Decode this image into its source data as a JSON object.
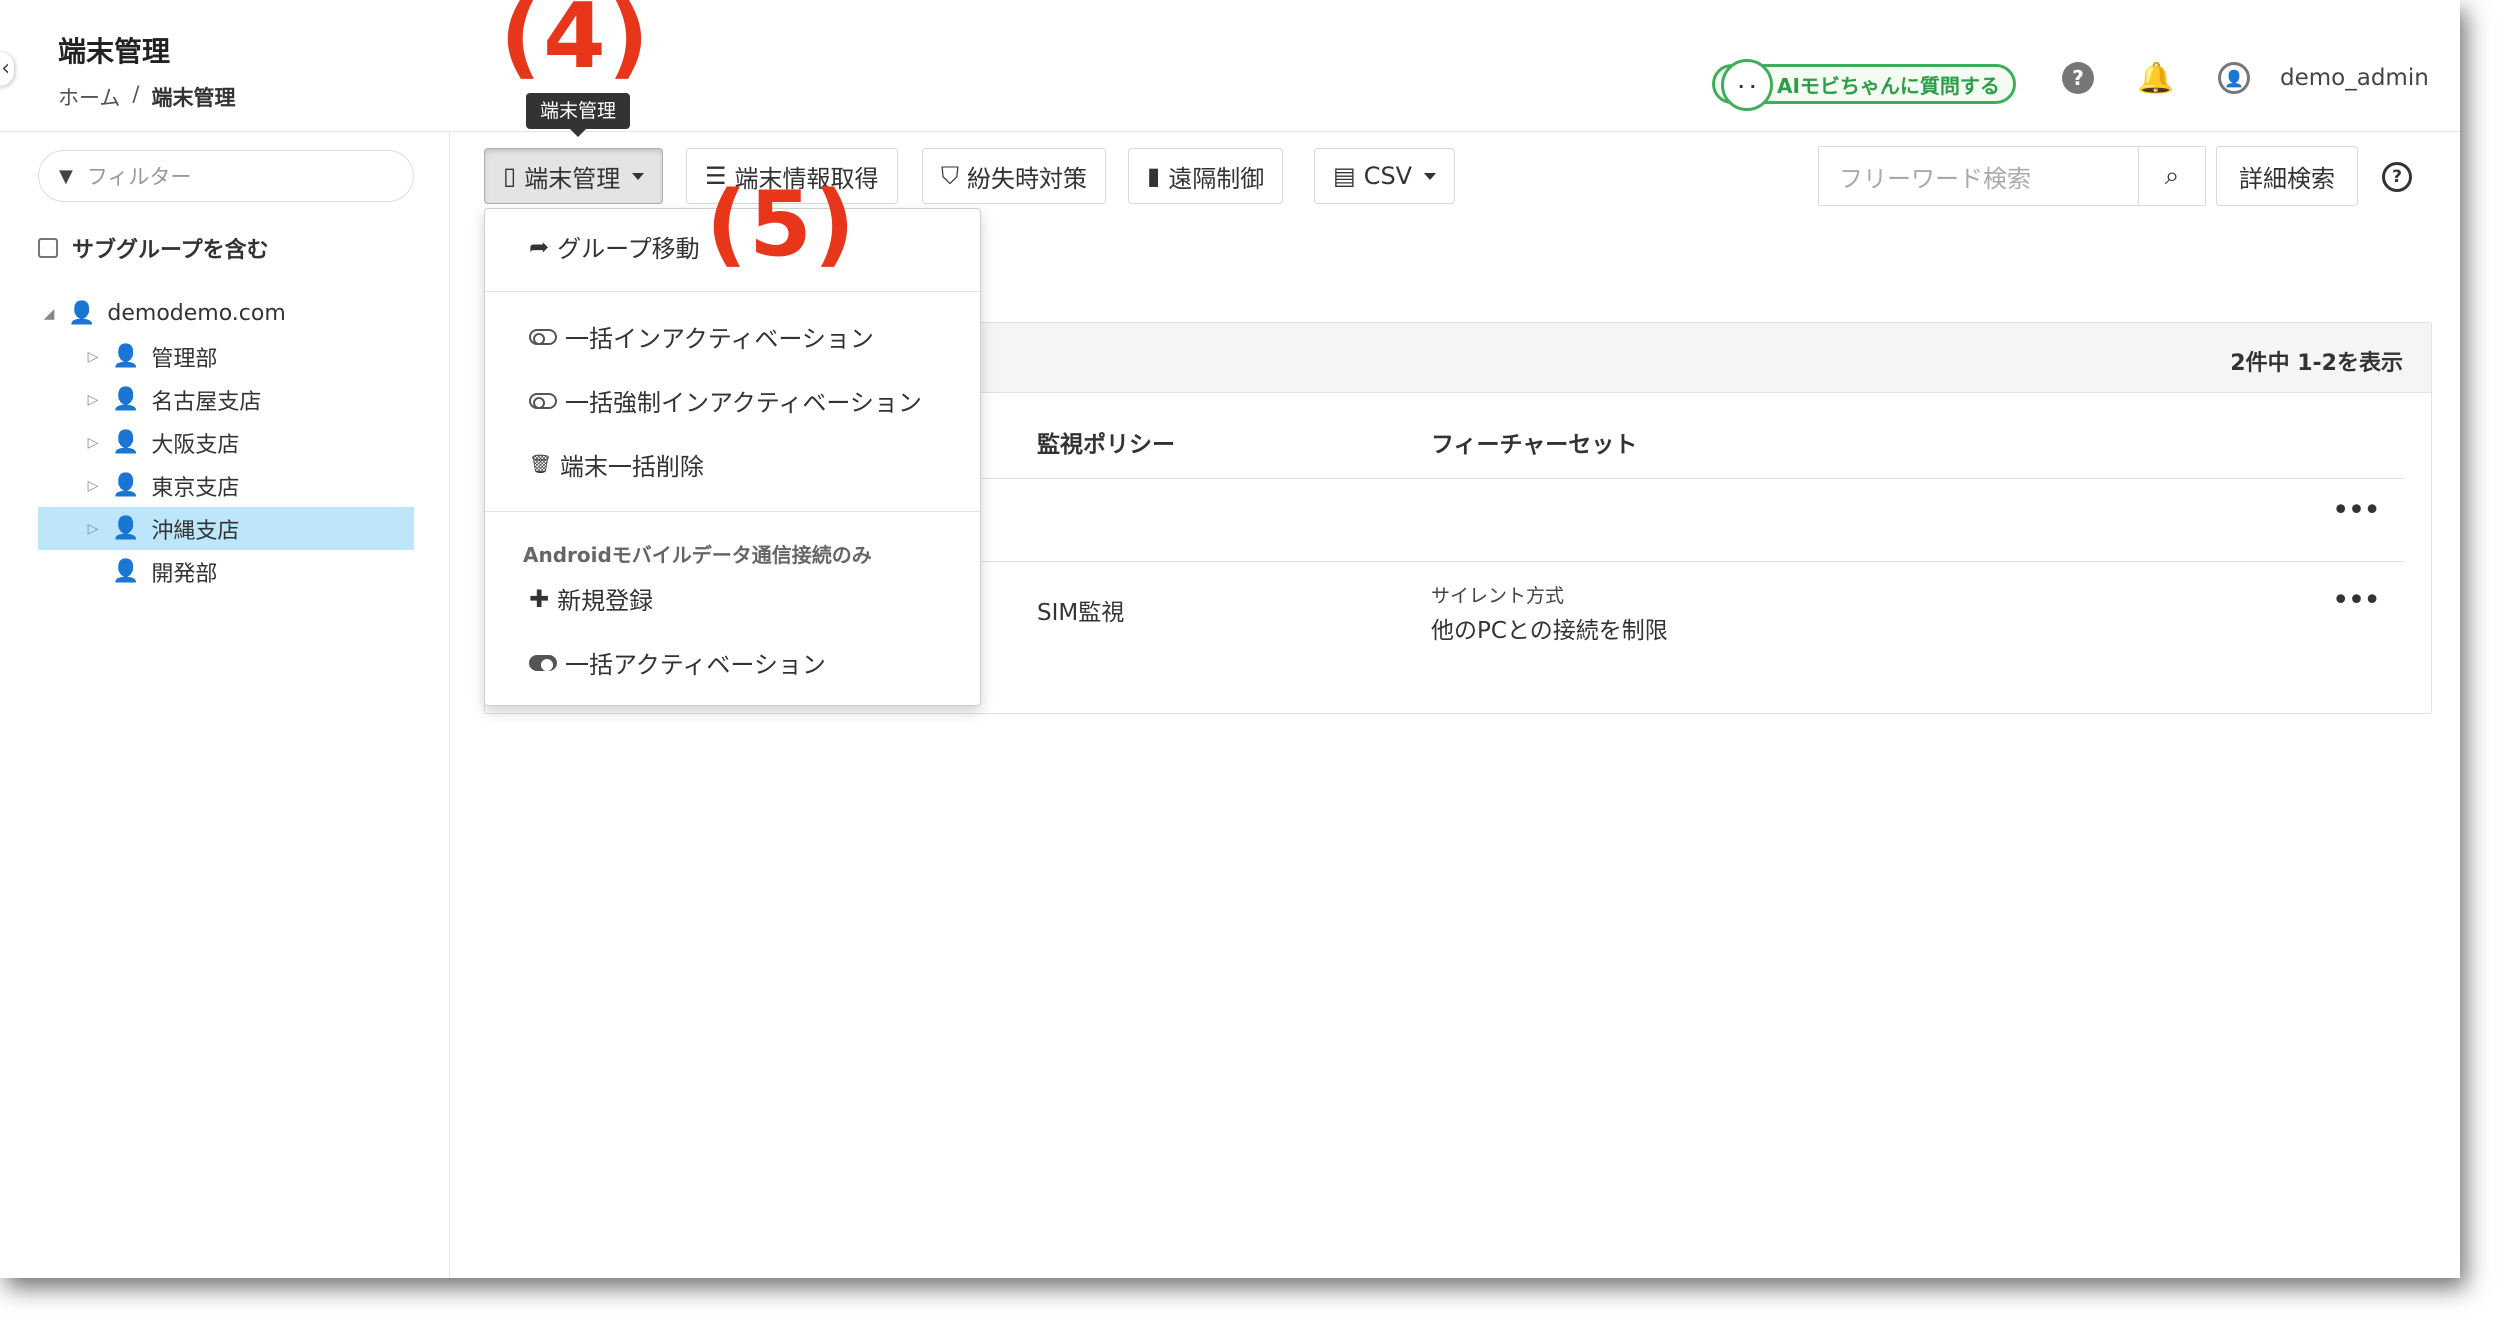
{
  "header": {
    "title": "端末管理",
    "breadcrumb": {
      "home": "ホーム",
      "separator": "/",
      "current": "端末管理"
    },
    "ai_badge": "AIモビちゃんに質問する",
    "ai_face": "· ·",
    "help_icon": "?",
    "bell_icon": "🔔",
    "user_icon": "👤",
    "username": "demo_admin"
  },
  "sidebar": {
    "filter_placeholder": "フィルター",
    "filter_icon": "▼",
    "include_subgroups": "サブグループを含む",
    "tree": [
      {
        "label": "demodemo.com",
        "toggle": "◢",
        "level": 0,
        "selected": false
      },
      {
        "label": "管理部",
        "toggle": "▷",
        "level": 1,
        "selected": false
      },
      {
        "label": "名古屋支店",
        "toggle": "▷",
        "level": 1,
        "selected": false
      },
      {
        "label": "大阪支店",
        "toggle": "▷",
        "level": 1,
        "selected": false
      },
      {
        "label": "東京支店",
        "toggle": "▷",
        "level": 1,
        "selected": false
      },
      {
        "label": "沖縄支店",
        "toggle": "▷",
        "level": 1,
        "selected": true
      },
      {
        "label": "開発部",
        "toggle": "",
        "level": 1,
        "selected": false
      }
    ]
  },
  "toolbar": {
    "device_mgmt": {
      "icon": "▯",
      "label": "端末管理"
    },
    "device_info": {
      "icon": "☰",
      "label": "端末情報取得"
    },
    "loss_measures": {
      "icon": "⛉",
      "label": "紛失時対策"
    },
    "remote_control": {
      "icon": "▮",
      "label": "遠隔制御"
    },
    "csv": {
      "icon": "▤",
      "label": "CSV"
    },
    "search_placeholder": "フリーワード検索",
    "search_icon": "⌕",
    "detail_search": "詳細検索",
    "help": "?"
  },
  "tooltip": "端末管理",
  "callouts": {
    "four": "(4)",
    "five": "(5)"
  },
  "dropdown": {
    "group_move": {
      "icon": "➦",
      "label": "グループ移動"
    },
    "bulk_inactivate": "一括インアクティベーション",
    "bulk_force_inactivate": "一括強制インアクティベーション",
    "bulk_delete": {
      "icon": "🗑",
      "label": "端末一括削除"
    },
    "android_header": "Androidモバイルデータ通信接続のみ",
    "new_register": {
      "icon": "✚",
      "label": "新規登録"
    },
    "bulk_activate": "一括アクティベーション"
  },
  "table": {
    "count_text": "2件中 1-2を表示",
    "columns": {
      "policy": "監視ポリシー",
      "featureset": "フィーチャーセット"
    },
    "rows": [
      {
        "policy": "",
        "featureset_line1": "",
        "featureset_line2": "",
        "menu": "•••"
      },
      {
        "policy": "SIM監視",
        "featureset_line1": "サイレント方式",
        "featureset_line2": "他のPCとの接続を制限",
        "menu": "•••"
      }
    ]
  }
}
